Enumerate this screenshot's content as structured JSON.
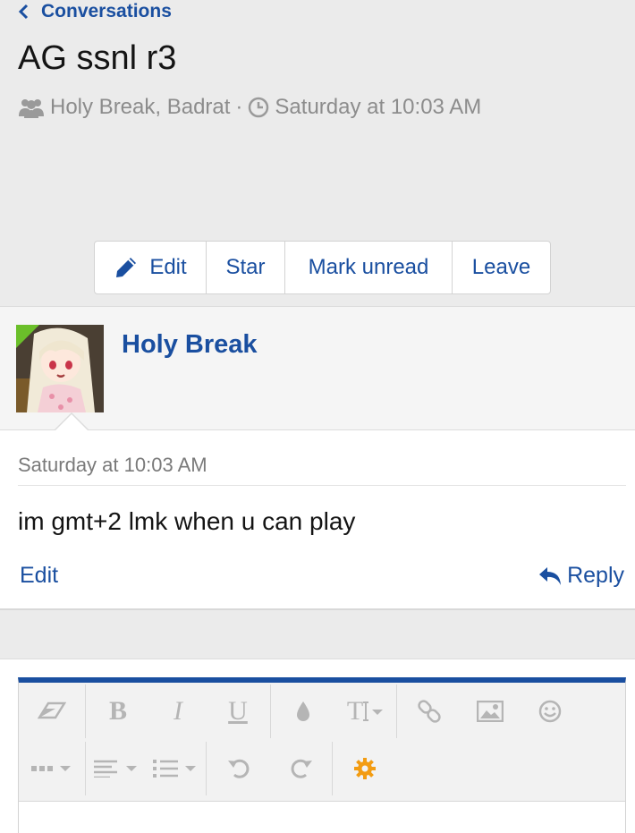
{
  "breadcrumb": {
    "label": "Conversations"
  },
  "conversation": {
    "title": "AG ssnl r3",
    "participants": "Holy Break, Badrat",
    "meta_separator": "·",
    "started": "Saturday at 10:03 AM"
  },
  "actions": {
    "edit": "Edit",
    "star": "Star",
    "mark_unread": "Mark unread",
    "leave": "Leave"
  },
  "message": {
    "author": "Holy Break",
    "timestamp": "Saturday at 10:03 AM",
    "text": "im gmt+2 lmk when u can play",
    "edit_label": "Edit",
    "reply_label": "Reply"
  },
  "editor": {
    "bold": "B",
    "italic": "I",
    "underline": "U",
    "text_size": "T"
  },
  "colors": {
    "link": "#1a4fa0",
    "online_indicator": "#6bbf2a",
    "settings_icon": "#f39c12"
  }
}
